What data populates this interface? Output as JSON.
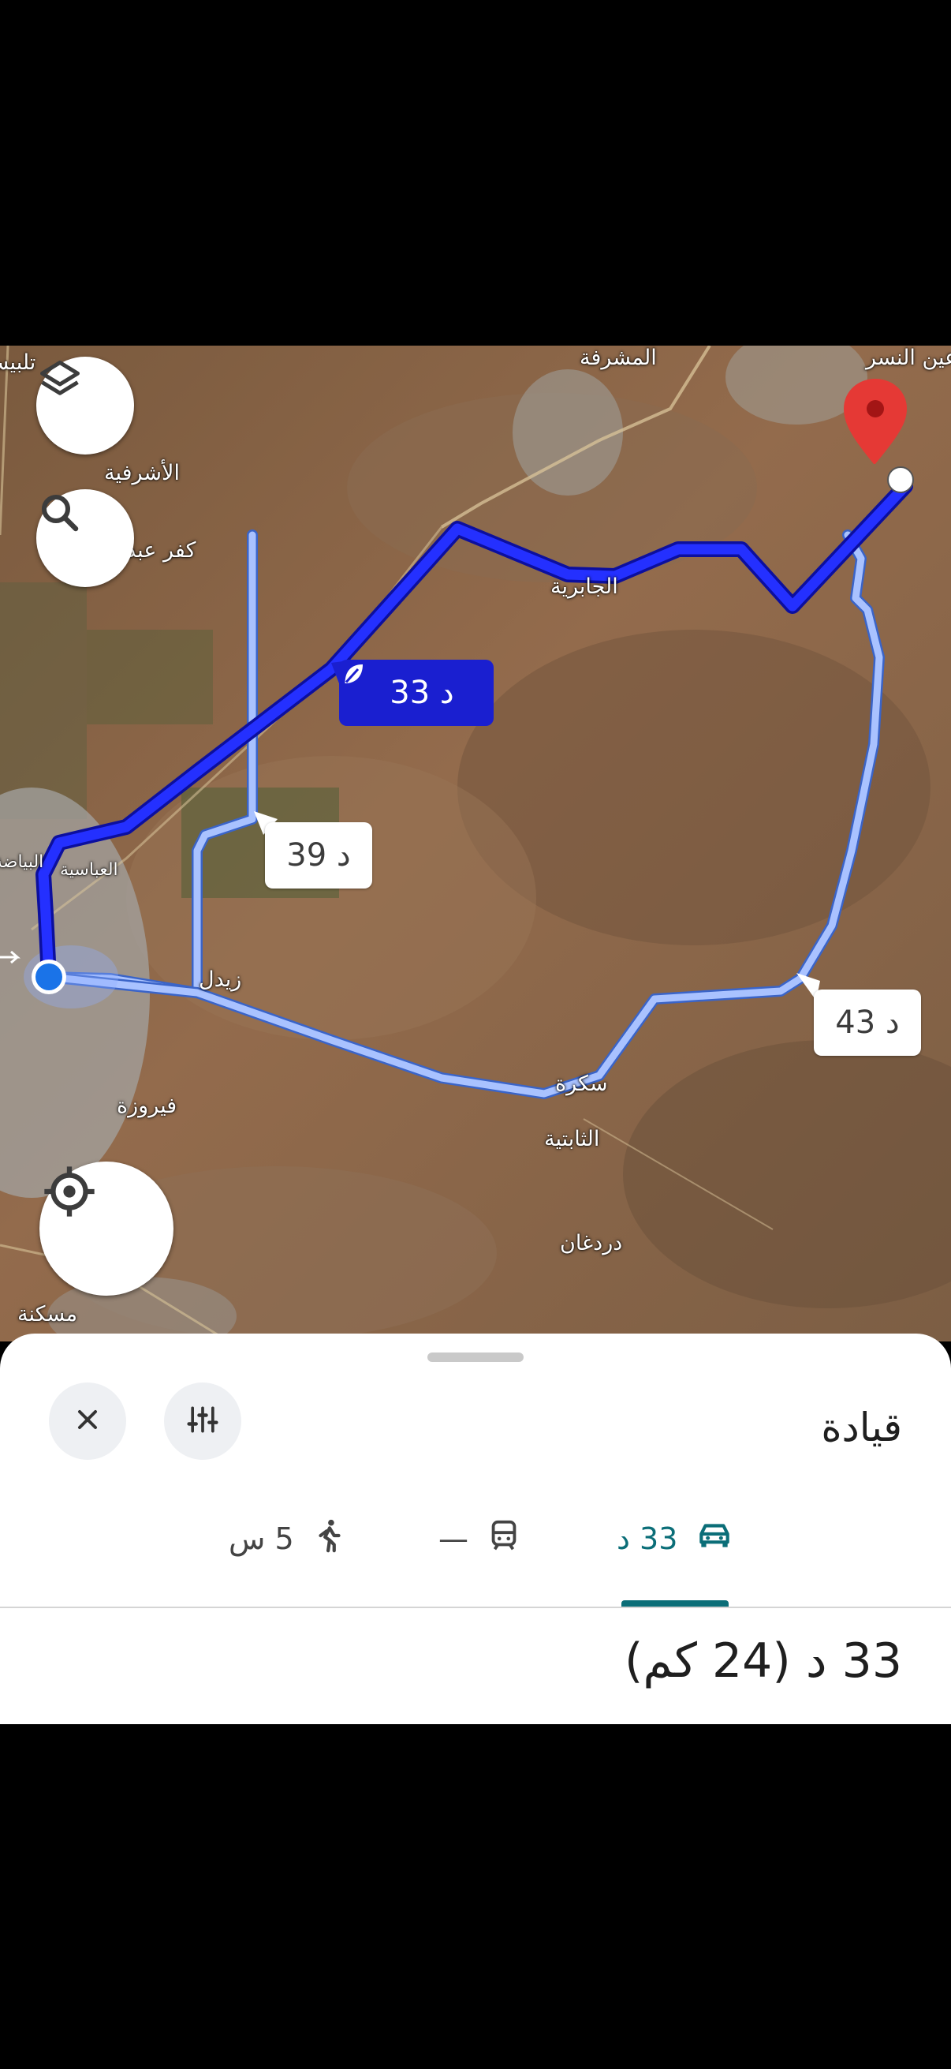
{
  "map": {
    "places": [
      {
        "id": "mushrifa",
        "name": "المشرفة"
      },
      {
        "id": "ain-nasr",
        "name": "عين النسر"
      },
      {
        "id": "talbiseh",
        "name": "تلبيسة"
      },
      {
        "id": "ashrafiya",
        "name": "الأشرفية"
      },
      {
        "id": "kafr-abd",
        "name": "كفر عبد"
      },
      {
        "id": "jabriya",
        "name": "الجابرية"
      },
      {
        "id": "bayyada",
        "name": "البياضة"
      },
      {
        "id": "abbasiya",
        "name": "العباسية"
      },
      {
        "id": "zaydal",
        "name": "زيدل"
      },
      {
        "id": "fayruza",
        "name": "فيروزة"
      },
      {
        "id": "sukra",
        "name": "سكرة"
      },
      {
        "id": "thabitiya",
        "name": "الثابتية"
      },
      {
        "id": "dardghan",
        "name": "دردغان"
      },
      {
        "id": "maskana",
        "name": "مسكنة"
      }
    ],
    "routes": [
      {
        "id": "primary",
        "duration_label": "33 د",
        "eco_icon": "leaf-icon",
        "color": "#1a1fd0"
      },
      {
        "id": "alt-39",
        "duration_label": "39 د",
        "color": "#9db8ff"
      },
      {
        "id": "alt-43",
        "duration_label": "43 د",
        "color": "#9db8ff"
      }
    ],
    "controls": {
      "layers_icon": "layers-icon",
      "search_icon": "search-icon",
      "location_icon": "my-location-icon"
    },
    "colors": {
      "origin": "#1a73e8",
      "destination_pin": "#e53935"
    }
  },
  "sheet": {
    "title": "قيادة",
    "close_icon": "close-icon",
    "options_icon": "tune-icon",
    "modes": [
      {
        "id": "drive",
        "icon": "car-icon",
        "label": "33 د",
        "selected": true
      },
      {
        "id": "transit",
        "icon": "train-icon",
        "label": "—",
        "selected": false
      },
      {
        "id": "walk",
        "icon": "walk-icon",
        "label": "5 س",
        "selected": false
      }
    ],
    "route_summary": "33 د (24 كم)",
    "accent_color": "#0b6e78"
  }
}
